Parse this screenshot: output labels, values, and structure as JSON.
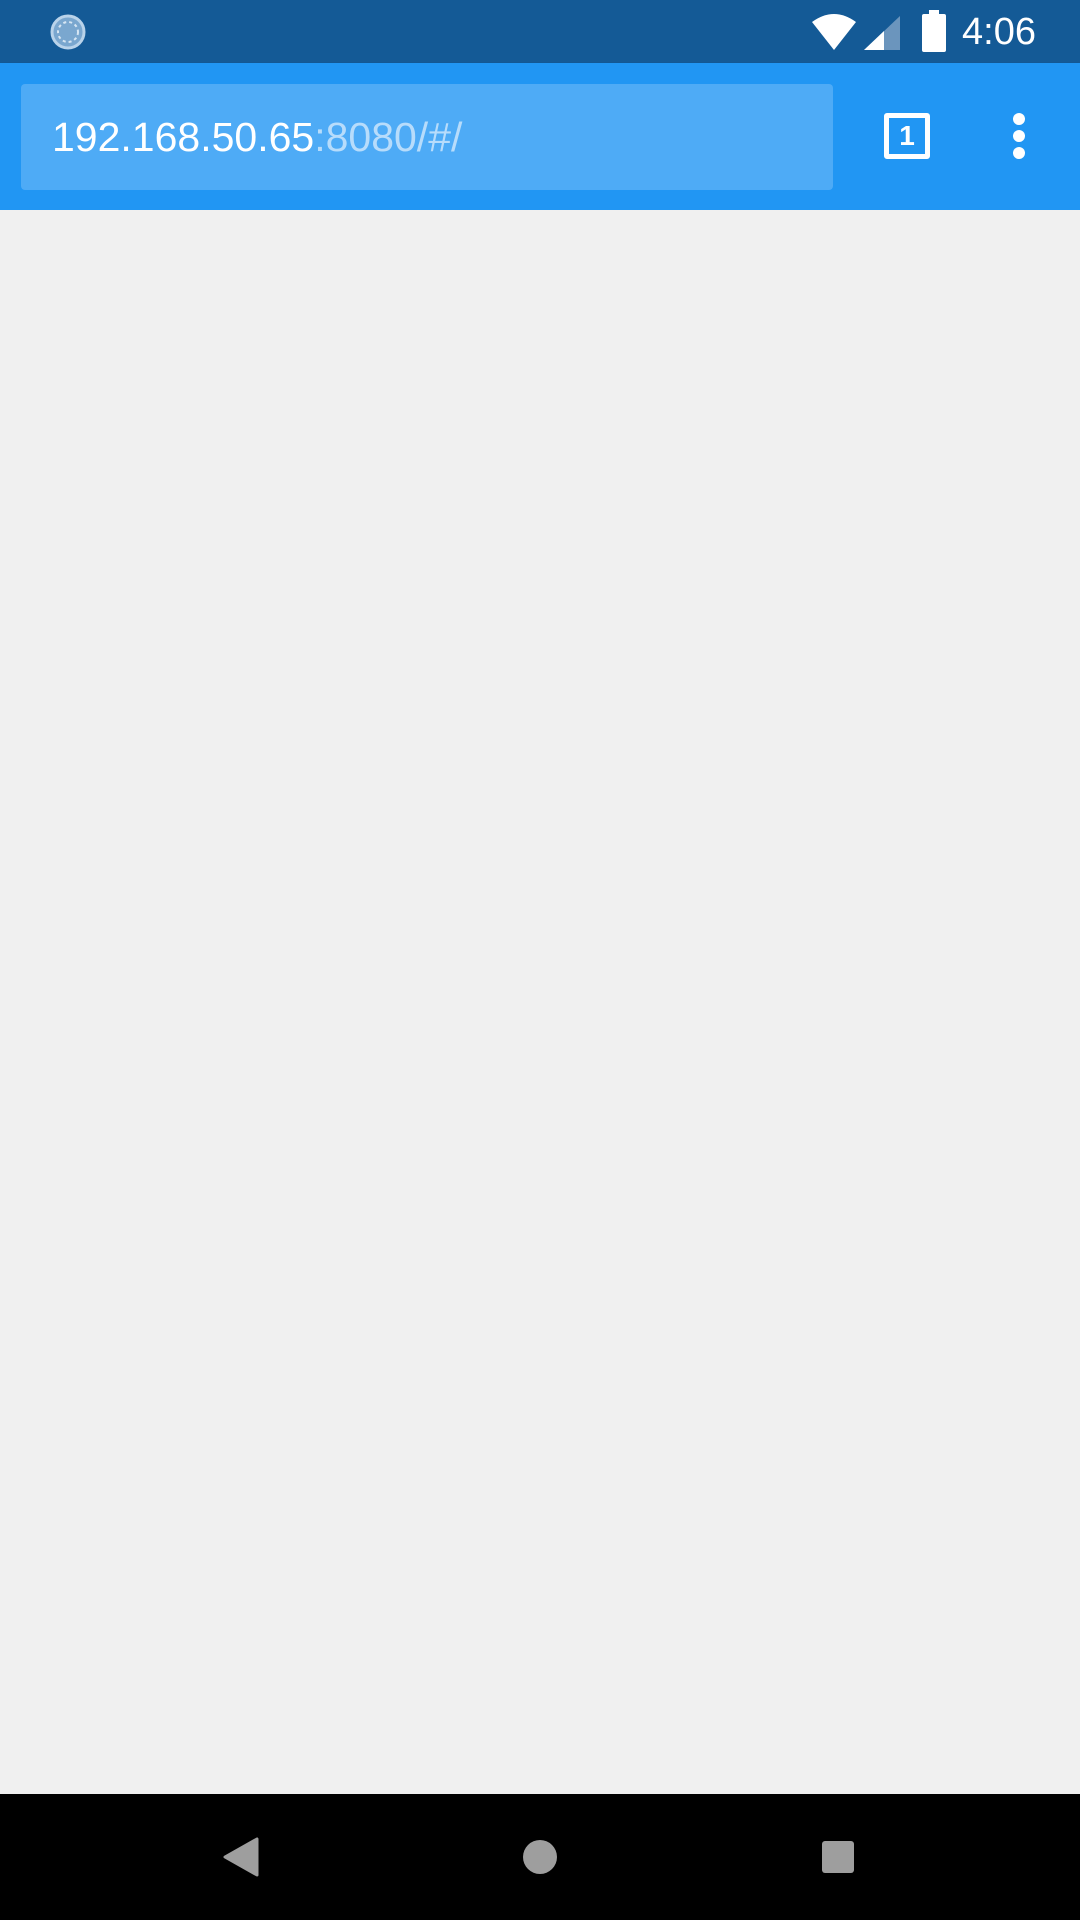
{
  "status_bar": {
    "time": "4:06",
    "icons": [
      "sync-icon",
      "wifi-icon",
      "cell-signal-icon",
      "battery-icon"
    ],
    "background": "#145a96"
  },
  "toolbar": {
    "background": "#2196f3",
    "url_host": "192.168.50.65",
    "url_rest": ":8080/#/",
    "tab_count": "1"
  },
  "content": {
    "background": "#f0f0f0"
  },
  "nav_bar": {
    "buttons": [
      "back-icon",
      "home-icon",
      "recents-icon"
    ],
    "background": "#000000"
  }
}
